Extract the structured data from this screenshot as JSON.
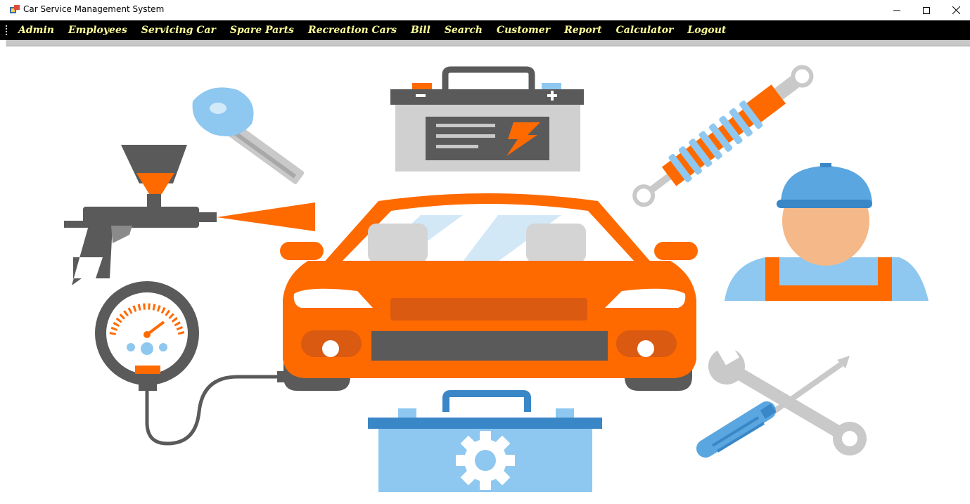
{
  "window": {
    "title": "Car Service Management System",
    "controls": [
      "minimize",
      "maximize",
      "close"
    ]
  },
  "menu": {
    "items": [
      {
        "label": "Admin"
      },
      {
        "label": "Employees"
      },
      {
        "label": "Servicing Car"
      },
      {
        "label": "Spare Parts"
      },
      {
        "label": "Recreation Cars"
      },
      {
        "label": "Bill"
      },
      {
        "label": "Search"
      },
      {
        "label": "Customer"
      },
      {
        "label": "Report"
      },
      {
        "label": "Calculator"
      },
      {
        "label": "Logout"
      }
    ],
    "text_color": "#ffff99",
    "background": "#000000"
  },
  "illustration": {
    "icons": [
      "car-key-icon",
      "car-battery-icon",
      "shock-absorber-icon",
      "spray-gun-icon",
      "car-front-icon",
      "mechanic-icon",
      "pressure-gauge-icon",
      "toolbox-icon",
      "wrench-screwdriver-icon"
    ],
    "colors": {
      "orange": "#ff6a00",
      "blue": "#8ec8f0",
      "gray": "#5a5a5a",
      "light_gray": "#c9c9c9"
    }
  }
}
